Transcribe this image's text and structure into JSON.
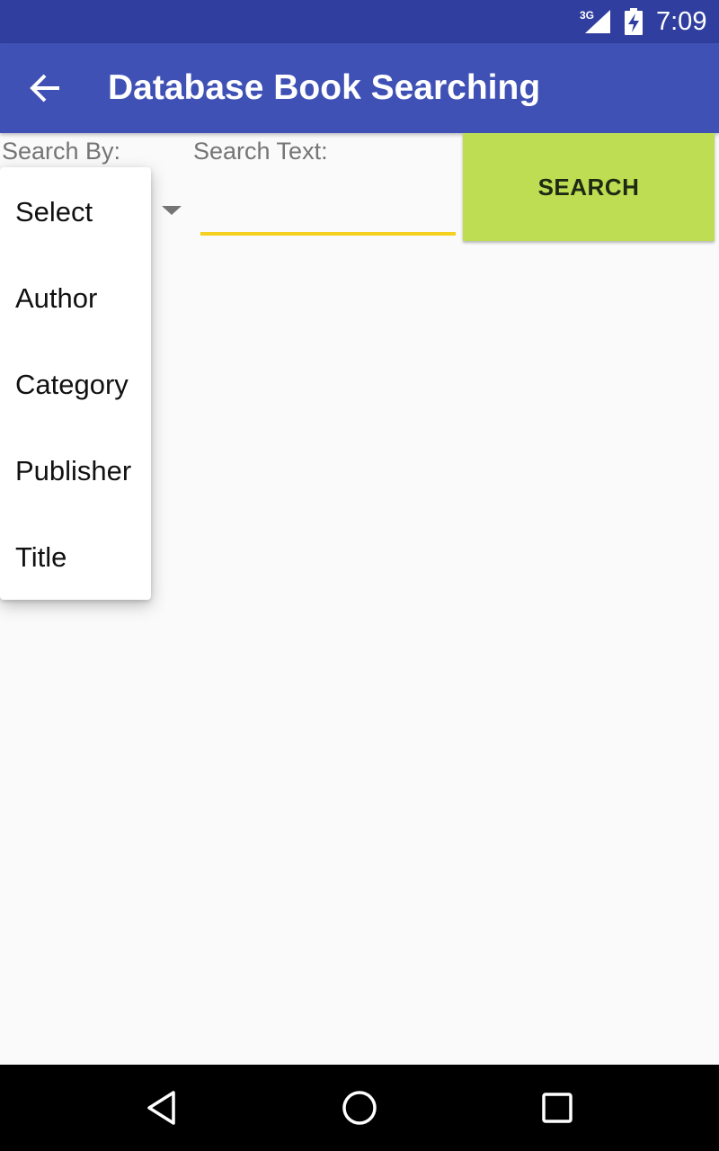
{
  "status_bar": {
    "network_label": "3G",
    "time": "7:09"
  },
  "app_bar": {
    "title": "Database Book Searching",
    "back_icon": "arrow-back-icon"
  },
  "form": {
    "search_by_label": "Search By:",
    "search_text_label": "Search Text:",
    "search_text_value": "",
    "search_button_label": "SEARCH",
    "accent_color": "#f5d01e",
    "button_color": "#bedd52"
  },
  "dropdown": {
    "options": [
      "Select",
      "Author",
      "Category",
      "Publisher",
      "Title"
    ]
  },
  "nav_bar": {
    "icons": [
      "back-triangle-icon",
      "home-circle-icon",
      "recents-square-icon"
    ]
  },
  "colors": {
    "primary": "#3f51b5",
    "primary_dark": "#303f9f"
  }
}
